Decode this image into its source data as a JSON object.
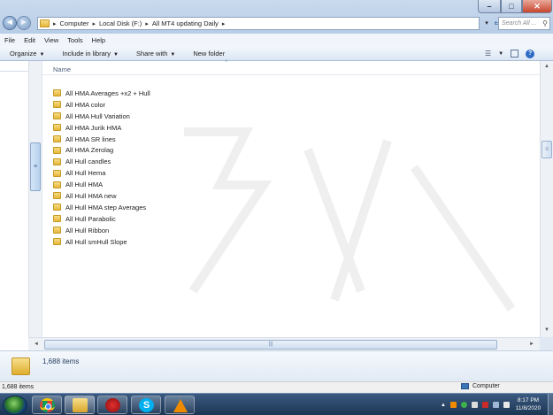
{
  "window": {
    "address": {
      "crumbs": [
        "Computer",
        "Local Disk (F:)",
        "All MT4 updating Daily"
      ]
    },
    "search_placeholder": "Search All ...",
    "controls": {
      "minimize": "–",
      "maximize": "□",
      "close": "✕"
    }
  },
  "menu": [
    "File",
    "Edit",
    "View",
    "Tools",
    "Help"
  ],
  "toolbar": {
    "organize": "Organize",
    "include_in_library": "Include in library",
    "share_with": "Share with",
    "new_folder": "New folder"
  },
  "list": {
    "column_name": "Name",
    "items": [
      "All  HMA Averages +x2 + Hull",
      "All  HMA color",
      "All  HMA Hull Variation",
      "All  HMA Jurik HMA",
      "All  HMA SR lines",
      "All  HMA Zerolag",
      "All  Hull candles",
      "All  Hull Hema",
      "All  Hull HMA",
      "All  Hull HMA new",
      "All  Hull HMA step Averages",
      "All  Hull Parabolic",
      "All  Hull Ribbon",
      "All  Hull smHull Slope"
    ]
  },
  "details": {
    "item_count": "1,688 items"
  },
  "statusbar": {
    "item_count": "1,688 items",
    "location": "Computer"
  },
  "taskbar": {
    "apps": [
      "chrome-icon",
      "explorer-icon",
      "gift-icon",
      "skype-icon",
      "vlc-icon"
    ],
    "skype_glyph": "S",
    "clock_time": "8:17 PM",
    "clock_date": "11/8/2020"
  },
  "colors": {
    "accent": "#2b6bc4",
    "taskbar": "#1c3553",
    "folder": "#e6b73a"
  }
}
